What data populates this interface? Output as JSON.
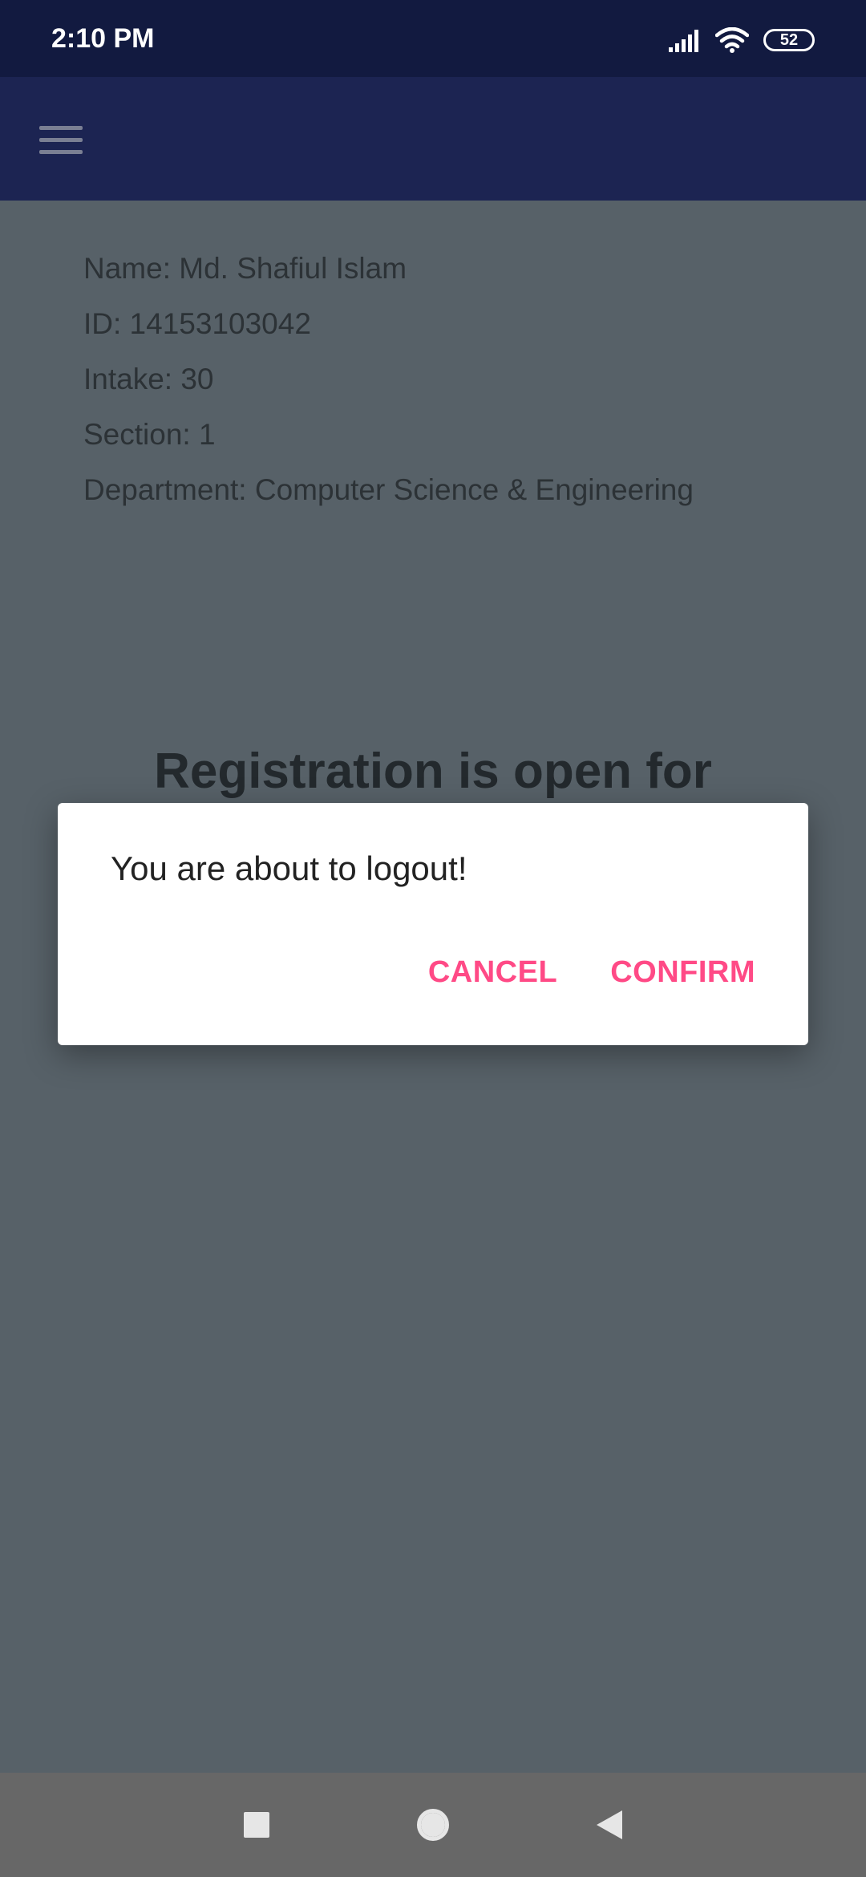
{
  "status_bar": {
    "time": "2:10 PM",
    "battery_level": "52",
    "icons": [
      "signal-icon",
      "wifi-icon",
      "battery-icon"
    ]
  },
  "app_bar": {
    "menu_icon": "hamburger-menu-icon"
  },
  "student_info": {
    "lines": [
      "Name: Md. Shafiul Islam",
      "ID: 14153103042",
      "Intake: 30",
      "Section: 1",
      "Department: Computer Science & Engineering"
    ]
  },
  "banner": {
    "title": "Registration is open for"
  },
  "dialog": {
    "message": "You are about to logout!",
    "cancel_label": "CANCEL",
    "confirm_label": "CONFIRM"
  },
  "nav_bar": {
    "icons": [
      "recents-icon",
      "home-icon",
      "back-icon"
    ]
  },
  "colors": {
    "accent": "#ff4a86",
    "status_bar": "#121a40",
    "app_bar": "#1c2452"
  }
}
